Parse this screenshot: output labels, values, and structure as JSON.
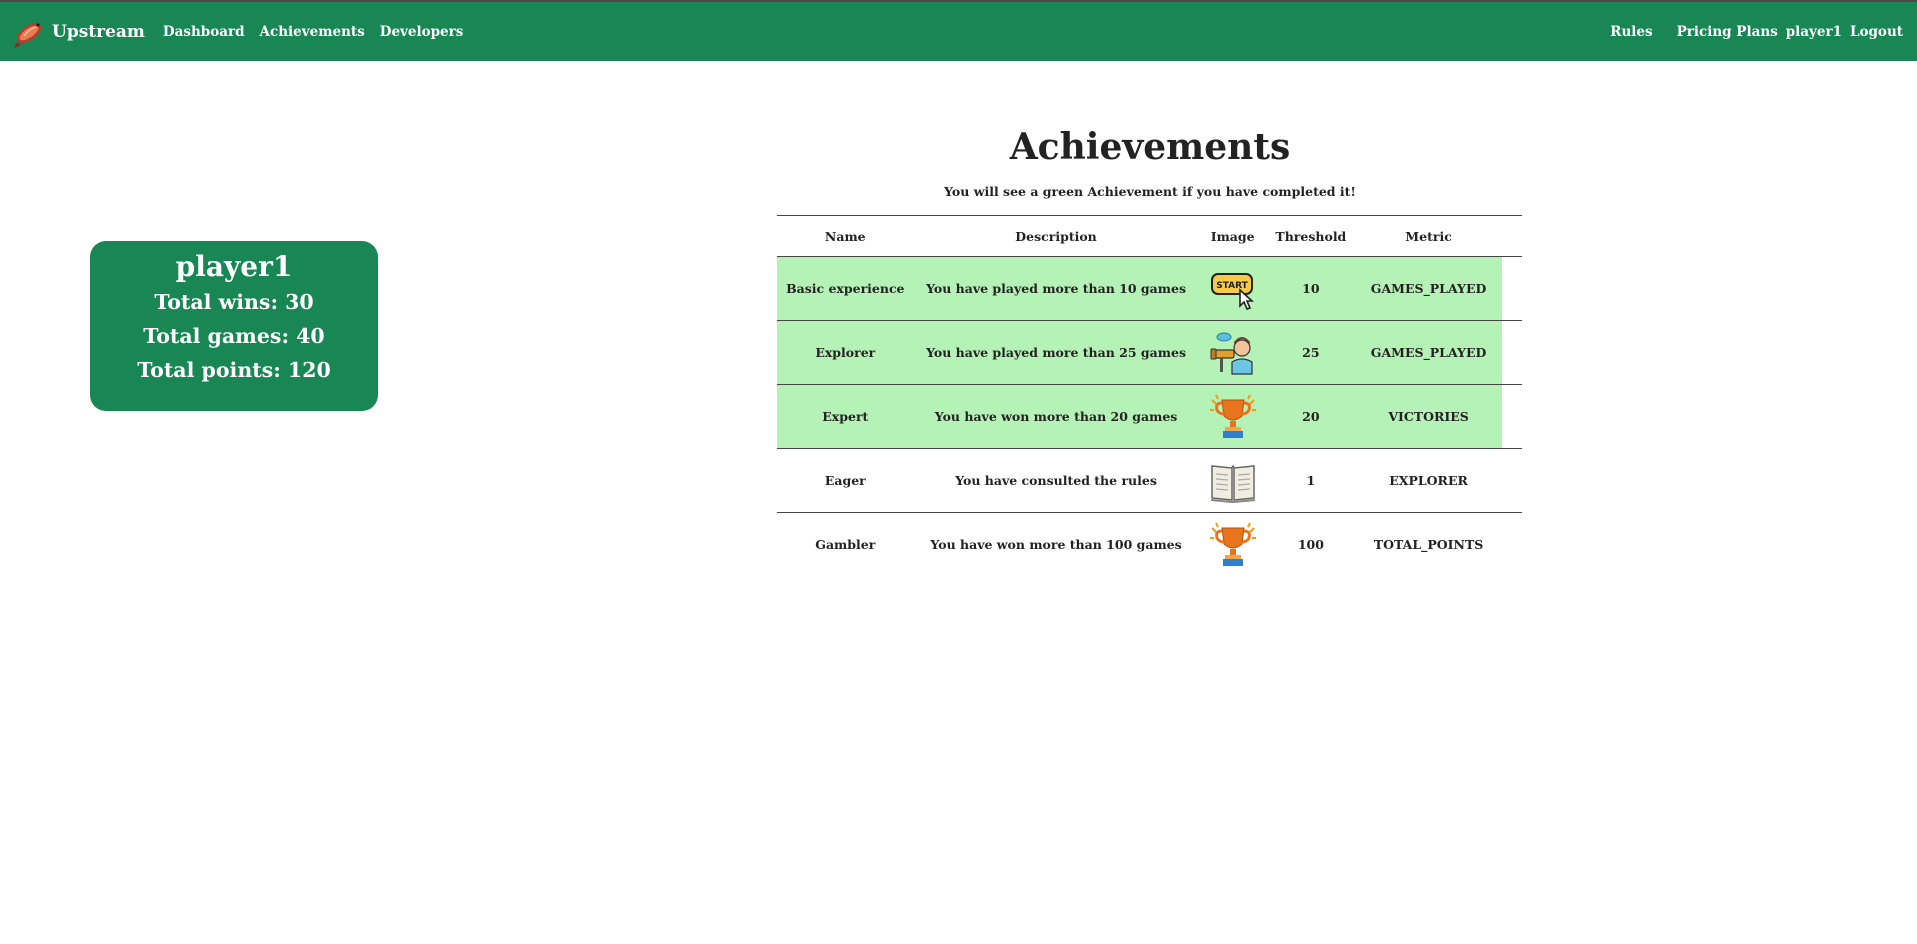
{
  "navbar": {
    "brand": "Upstream",
    "left_links": [
      "Dashboard",
      "Achievements",
      "Developers"
    ],
    "right_links": {
      "rules": "Rules",
      "pricing": "Pricing Plans",
      "user": "player1",
      "logout": "Logout"
    },
    "color": "#198754"
  },
  "stats": {
    "username": "player1",
    "wins": "Total wins: 30",
    "games": "Total games: 40",
    "points": "Total points: 120"
  },
  "page": {
    "title": "Achievements",
    "subtitle": "You will see a green Achievement if you have completed it!"
  },
  "table": {
    "headers": {
      "name": "Name",
      "description": "Description",
      "image": "Image",
      "threshold": "Threshold",
      "metric": "Metric"
    },
    "completed_color": "#b5f2b5",
    "rows": [
      {
        "name": "Basic experience",
        "description": "You have played more than 10 games",
        "image": "start-button-icon",
        "threshold": "10",
        "metric": "GAMES_PLAYED",
        "completed": true
      },
      {
        "name": "Explorer",
        "description": "You have played more than 25 games",
        "image": "explorer-telescope-icon",
        "threshold": "25",
        "metric": "GAMES_PLAYED",
        "completed": true
      },
      {
        "name": "Expert",
        "description": "You have won more than 20 games",
        "image": "trophy-icon",
        "threshold": "20",
        "metric": "VICTORIES",
        "completed": true
      },
      {
        "name": "Eager",
        "description": "You have consulted the rules",
        "image": "open-book-icon",
        "threshold": "1",
        "metric": "EXPLORER",
        "completed": false
      },
      {
        "name": "Gambler",
        "description": "You have won more than 100 games",
        "image": "trophy-icon",
        "threshold": "100",
        "metric": "TOTAL_POINTS",
        "completed": false
      }
    ]
  }
}
